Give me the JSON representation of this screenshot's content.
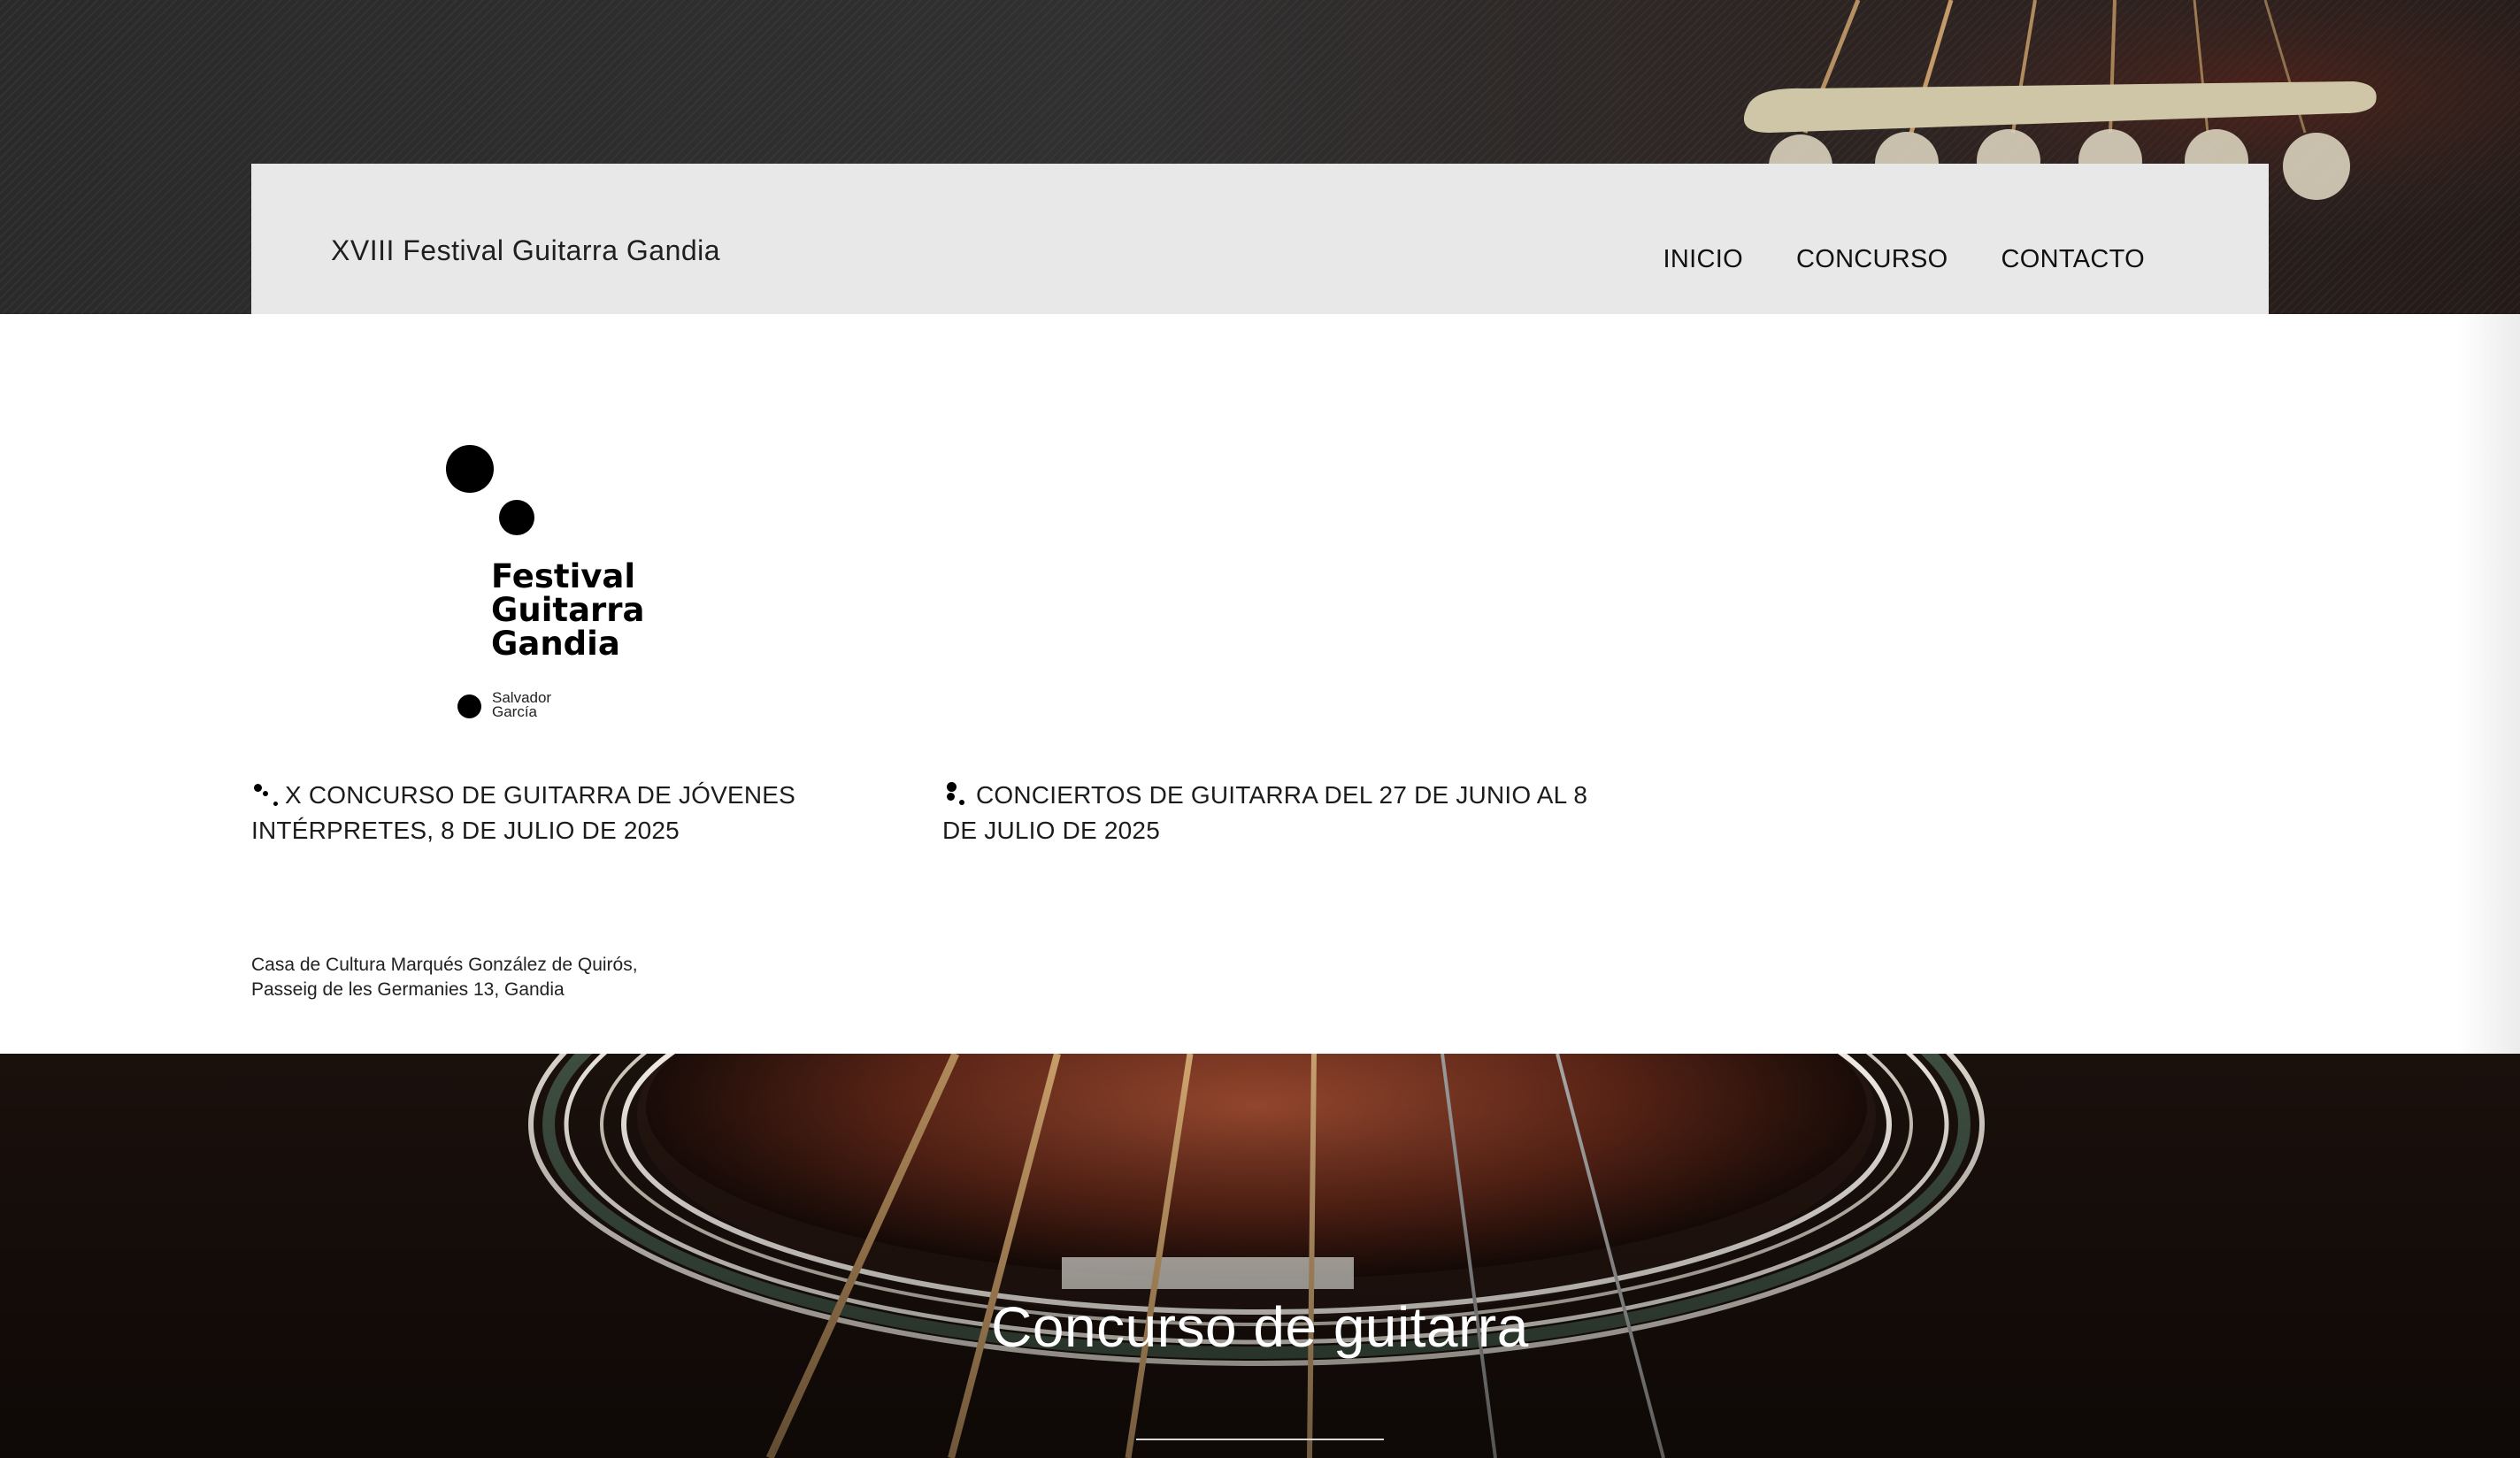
{
  "header": {
    "site_title": "XVIII Festival Guitarra Gandia",
    "nav": [
      "INICIO",
      "CONCURSO",
      "CONTACTO"
    ]
  },
  "logo": {
    "lines": [
      "Festival",
      "Guitarra",
      "Gandia"
    ],
    "sub": [
      "Salvador",
      "García"
    ]
  },
  "events": [
    {
      "icon": "two-dots-diagonal-icon",
      "text": "X CONCURSO DE GUITARRA DE JÓVENES INTÉRPRETES, 8 DE JULIO DE 2025"
    },
    {
      "icon": "three-dots-icon",
      "text": "CONCIERTOS DE GUITARRA DEL 27 DE JUNIO AL 8 DE JULIO DE 2025"
    }
  ],
  "address": [
    "Casa de Cultura Marqués González de Quirós,",
    "Passeig de les Germanies 13, Gandia"
  ],
  "section": {
    "title": "Concurso de guitarra"
  },
  "colors": {
    "header_bg": "#e8e8e8",
    "dark_band": "#2d2d2d",
    "text": "#1c1c1c"
  }
}
